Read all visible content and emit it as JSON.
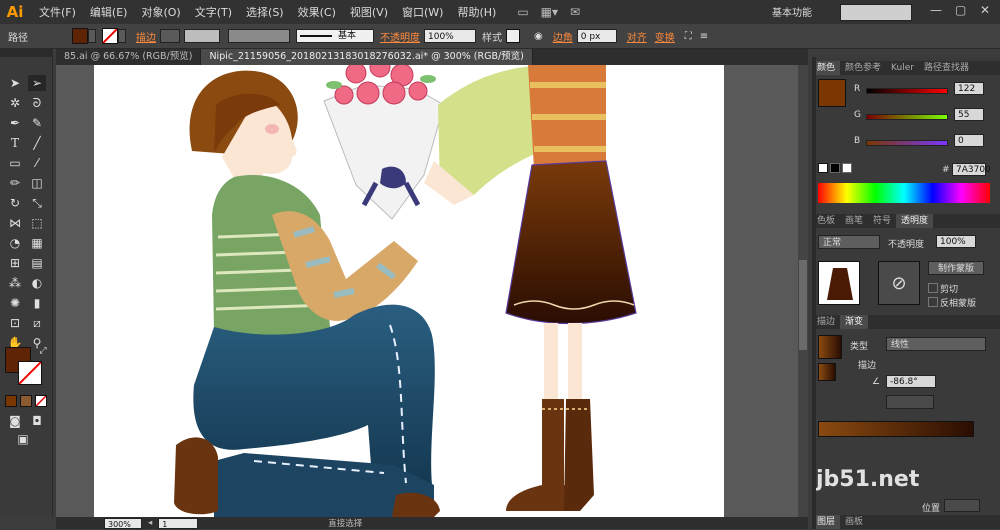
{
  "menubar": {
    "logo": "Ai",
    "items": [
      "文件(F)",
      "编辑(E)",
      "对象(O)",
      "文字(T)",
      "选择(S)",
      "效果(C)",
      "视图(V)",
      "窗口(W)",
      "帮助(H)"
    ],
    "workspace": "基本功能"
  },
  "controlbar": {
    "path_label": "路径",
    "stroke_label": "描边",
    "stroke_weight": "",
    "brush_label": "基本",
    "opacity_label": "不透明度",
    "opacity_value": "100%",
    "style_label": "样式",
    "corner_label": "边角",
    "corner_value": "0 px",
    "align_label": "对齐",
    "transform_label": "变换",
    "fill_color": "#5e2405",
    "accent_link_color": "#ff8a3c"
  },
  "doc_tabs": [
    {
      "label": "85.ai @ 66.67% (RGB/预览)",
      "active": false
    },
    {
      "label": "Nipic_21159056_20180213183018276032.ai* @ 300% (RGB/预览)",
      "active": true
    }
  ],
  "status": {
    "zoom": "300%",
    "page": "1",
    "tool_hint": "直接选择"
  },
  "color_panel": {
    "tabs": [
      "颜色",
      "颜色参考",
      "Kuler",
      "路径查找器"
    ],
    "r": "122",
    "g": "55",
    "b": "0",
    "hex": "7A3700",
    "swatch": "#7a3700"
  },
  "transparency_panel": {
    "tabs": [
      "色板",
      "画笔",
      "符号",
      "透明度"
    ],
    "blend_mode": "正常",
    "opacity_label": "不透明度",
    "opacity_value": "100%",
    "make_mask_button": "制作蒙版",
    "clip_label": "剪切",
    "invert_mask_label": "反相蒙版"
  },
  "gradient_panel": {
    "tabs": [
      "描边",
      "渐变"
    ],
    "type_label": "类型",
    "type_value": "线性",
    "stroke_label": "描边",
    "angle_value": "-86.8°",
    "location_label": "位置",
    "gradient_start": "#8a4a10",
    "gradient_end": "#2a0d02"
  },
  "bottom_panel": {
    "tabs": [
      "图层",
      "画板"
    ]
  },
  "watermark": "jb51.net"
}
